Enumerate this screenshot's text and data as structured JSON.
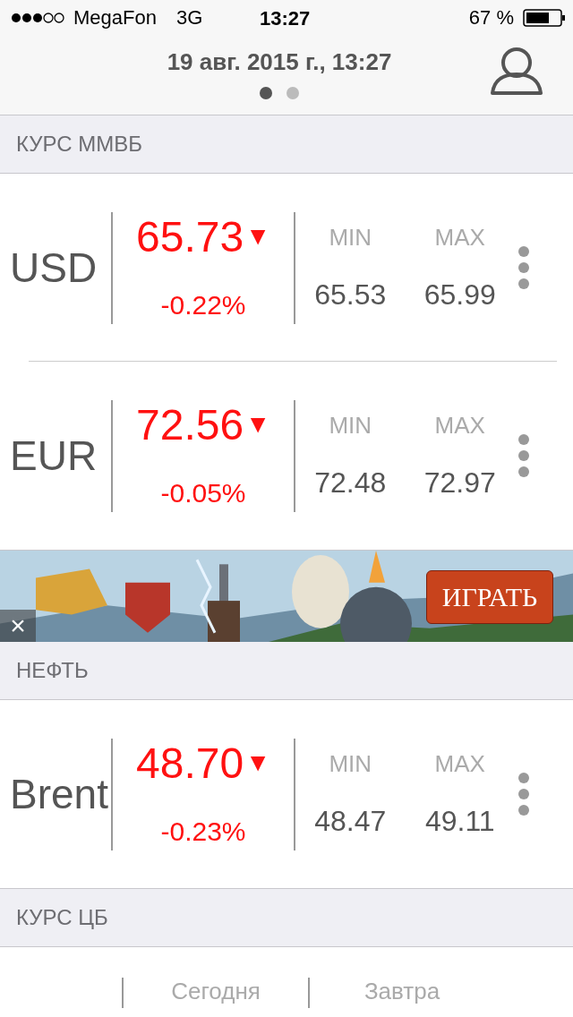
{
  "status_bar": {
    "carrier": "MegaFon",
    "network": "3G",
    "time": "13:27",
    "battery": "67 %"
  },
  "header": {
    "date": "19 авг. 2015 г., 13:27",
    "pages": [
      {
        "selected": true
      },
      {
        "selected": false
      }
    ]
  },
  "sections": [
    {
      "kind": "rates",
      "title": "КУРС ММВБ",
      "rows": [
        {
          "name": "USD",
          "price": "65.73",
          "arrow": "▼",
          "change": "-0.22%",
          "min_label": "MIN",
          "min": "65.53",
          "max_label": "MAX",
          "max": "65.99"
        },
        {
          "name": "EUR",
          "price": "72.56",
          "arrow": "▼",
          "change": "-0.05%",
          "min_label": "MIN",
          "min": "72.48",
          "max_label": "MAX",
          "max": "72.97"
        }
      ]
    },
    {
      "kind": "ad",
      "close": "×",
      "button": "ИГРАТЬ"
    },
    {
      "kind": "rates",
      "title": "НЕФТЬ",
      "rows": [
        {
          "name": "Brent",
          "price": "48.70",
          "arrow": "▼",
          "change": "-0.23%",
          "min_label": "MIN",
          "min": "48.47",
          "max_label": "MAX",
          "max": "49.11"
        }
      ]
    },
    {
      "kind": "cb",
      "title": "КУРС ЦБ",
      "columns": [
        "Сегодня",
        "Завтра"
      ]
    }
  ]
}
